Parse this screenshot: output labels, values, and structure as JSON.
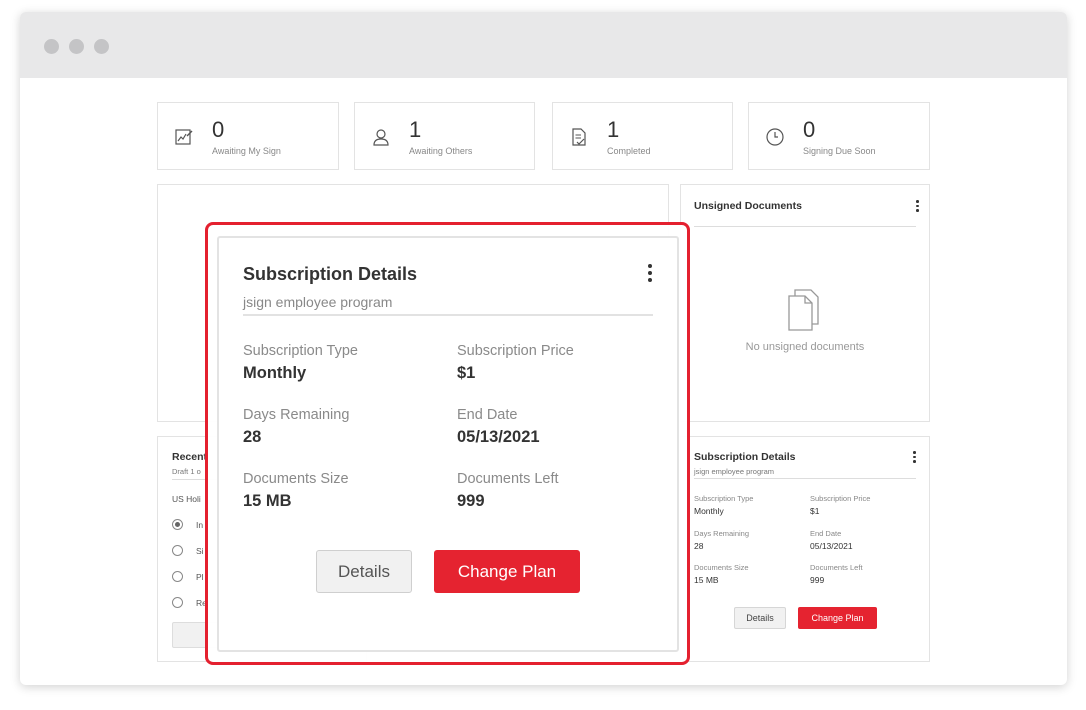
{
  "stats": [
    {
      "value": "0",
      "label": "Awaiting My Sign",
      "icon": "signature-icon"
    },
    {
      "value": "1",
      "label": "Awaiting Others",
      "icon": "user-icon"
    },
    {
      "value": "1",
      "label": "Completed",
      "icon": "document-check-icon"
    },
    {
      "value": "0",
      "label": "Signing Due Soon",
      "icon": "clock-icon"
    }
  ],
  "unsigned": {
    "title": "Unsigned Documents",
    "empty_text": "No unsigned documents"
  },
  "recent": {
    "title": "Recent",
    "sub": "Draft 1 o",
    "group_label": "US Holi",
    "options": [
      "In",
      "Si",
      "Pl",
      "Re"
    ]
  },
  "subscription": {
    "title": "Subscription Details",
    "subtitle": "jsign employee program",
    "fields": [
      {
        "label": "Subscription Type",
        "value": "Monthly"
      },
      {
        "label": "Subscription Price",
        "value": "$1"
      },
      {
        "label": "Days Remaining",
        "value": "28"
      },
      {
        "label": "End Date",
        "value": "05/13/2021"
      },
      {
        "label": "Documents Size",
        "value": "15 MB"
      },
      {
        "label": "Documents Left",
        "value": "999"
      }
    ],
    "details_label": "Details",
    "change_plan_label": "Change Plan"
  },
  "colors": {
    "accent": "#e52330",
    "highlight": "#e4202f"
  }
}
